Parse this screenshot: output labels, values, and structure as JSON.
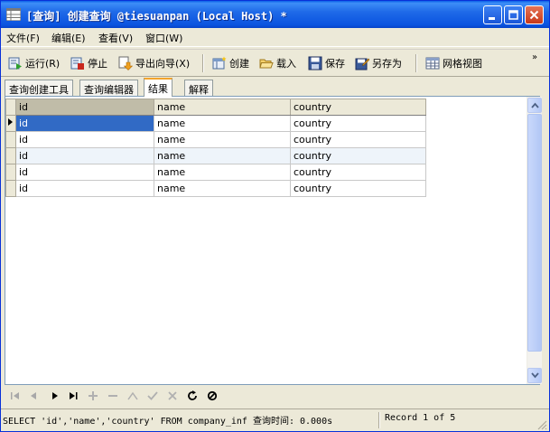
{
  "window": {
    "title": "[查询] 创建查询 @tiesuanpan (Local Host) *"
  },
  "menu": {
    "items": [
      {
        "label": "文件(F)"
      },
      {
        "label": "编辑(E)"
      },
      {
        "label": "查看(V)"
      },
      {
        "label": "窗口(W)"
      }
    ]
  },
  "toolbar": {
    "run": "运行(R)",
    "stop": "停止",
    "export_wizard": "导出向导(X)",
    "create": "创建",
    "load": "载入",
    "save": "保存",
    "save_as": "另存为",
    "grid_view": "网格视图",
    "more": "»"
  },
  "tabs": [
    {
      "label": "查询创建工具"
    },
    {
      "label": "查询编辑器"
    },
    {
      "label": "结果"
    },
    {
      "label": "解释"
    }
  ],
  "grid": {
    "columns": [
      "id",
      "name",
      "country"
    ],
    "rows": [
      [
        "id",
        "name",
        "country"
      ],
      [
        "id",
        "name",
        "country"
      ],
      [
        "id",
        "name",
        "country"
      ],
      [
        "id",
        "name",
        "country"
      ],
      [
        "id",
        "name",
        "country"
      ]
    ]
  },
  "status": {
    "sql": "SELECT 'id','name','country' FROM company_inf 查询时间: 0.000s",
    "record": "Record 1 of 5"
  },
  "colors": {
    "title_bar": "#0b54e0",
    "selection": "#316ac5",
    "tab_highlight": "#f2a42d"
  }
}
